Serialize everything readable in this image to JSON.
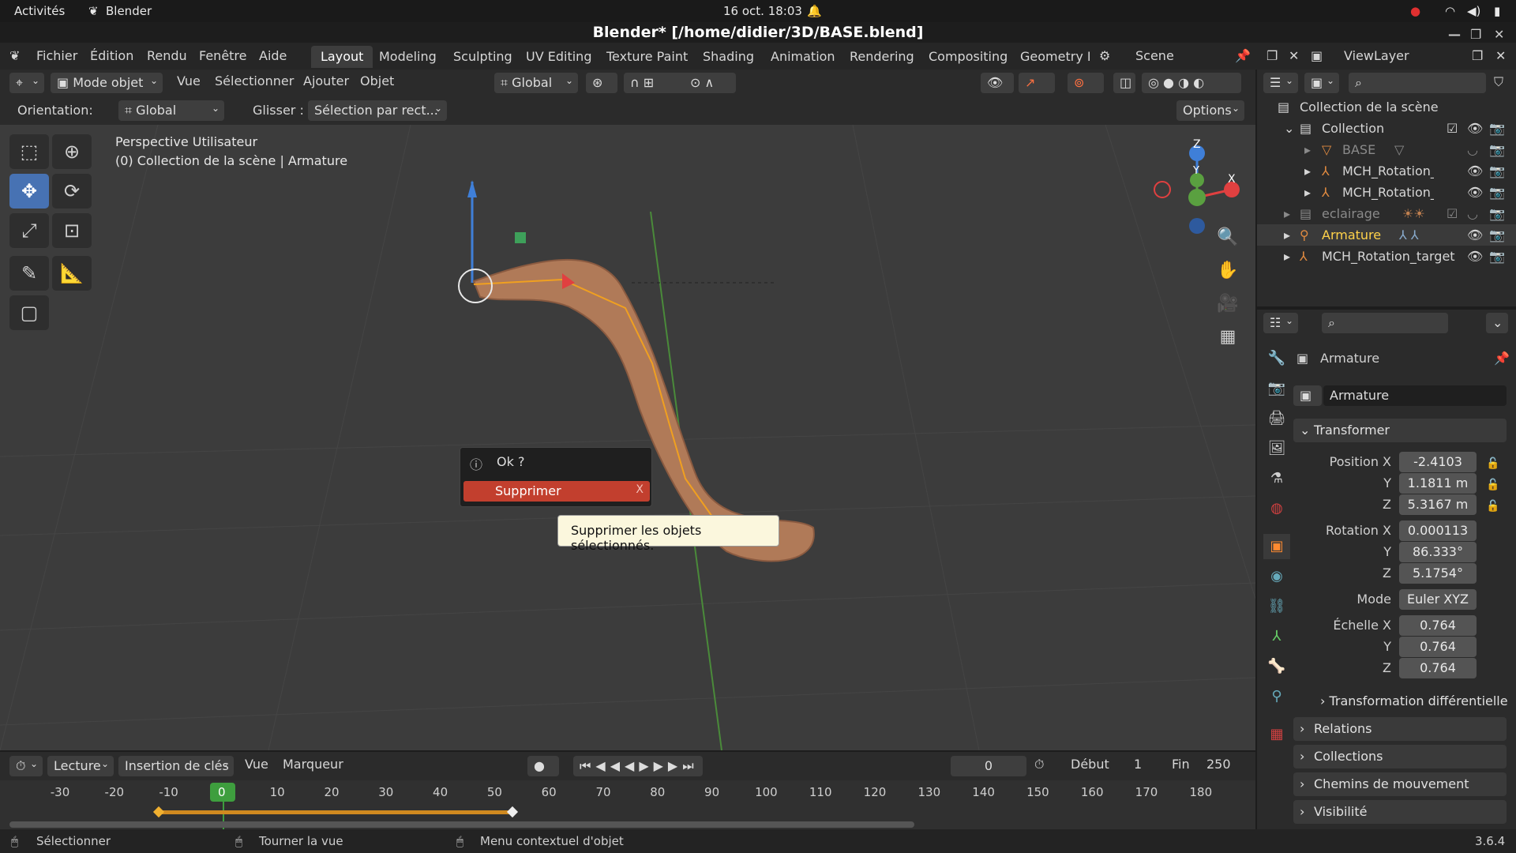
{
  "system": {
    "activities": "Activités",
    "app": "Blender",
    "datetime": "16 oct.  18:03"
  },
  "window": {
    "title": "Blender* [/home/didier/3D/BASE.blend]"
  },
  "menus": [
    "Fichier",
    "Édition",
    "Rendu",
    "Fenêtre",
    "Aide"
  ],
  "workspaces": [
    {
      "label": "Layout",
      "active": true
    },
    {
      "label": "Modeling"
    },
    {
      "label": "Sculpting"
    },
    {
      "label": "UV Editing"
    },
    {
      "label": "Texture Paint"
    },
    {
      "label": "Shading"
    },
    {
      "label": "Animation"
    },
    {
      "label": "Rendering"
    },
    {
      "label": "Compositing"
    },
    {
      "label": "Geometry N"
    }
  ],
  "scene": {
    "name": "Scene",
    "viewlayer": "ViewLayer"
  },
  "header": {
    "mode": "Mode objet",
    "view": "Vue",
    "select": "Sélectionner",
    "add": "Ajouter",
    "object": "Objet",
    "transform_orientation": "Global"
  },
  "toolsettings": {
    "orientation_label": "Orientation:",
    "orientation_value": "Global",
    "drag_label": "Glisser :",
    "drag_value": "Sélection par rect...",
    "options": "Options"
  },
  "viewport": {
    "line1": "Perspective Utilisateur",
    "line2": "(0) Collection de la scène | Armature",
    "axis_x": "X",
    "axis_y": "Y",
    "axis_z": "Z"
  },
  "popup": {
    "title": "Ok ?",
    "action": "Supprimer",
    "shortcut": "X"
  },
  "tooltip": {
    "text": "Supprimer les objets sélectionnés."
  },
  "outliner": {
    "root": "Collection de la scène",
    "rows": [
      {
        "label": "Collection",
        "level": 1
      },
      {
        "label": "BASE",
        "level": 2,
        "dim": true
      },
      {
        "label": "MCH_Rotation_ta",
        "level": 2
      },
      {
        "label": "MCH_Rotation_ta",
        "level": 2
      },
      {
        "label": "eclairage",
        "level": 1,
        "dim": true
      },
      {
        "label": "Armature",
        "level": 1,
        "active": true
      },
      {
        "label": "MCH_Rotation_target",
        "level": 1
      }
    ]
  },
  "properties": {
    "object_name": "Armature",
    "data_name": "Armature",
    "panel_transform": "Transformer",
    "position": {
      "label": "Position X",
      "x": "-2.4103",
      "y": "1.1811 m",
      "z": "5.3167 m"
    },
    "rotation": {
      "label": "Rotation X",
      "x": "0.000113",
      "y": "86.333°",
      "z": "5.1754°"
    },
    "mode": {
      "label": "Mode",
      "value": "Euler XYZ"
    },
    "scale": {
      "label": "Échelle X",
      "x": "0.764",
      "y": "0.764",
      "z": "0.764"
    },
    "axis_y": "Y",
    "axis_z": "Z",
    "delta": "Transformation différentielle",
    "relations": "Relations",
    "collections": "Collections",
    "motion_paths": "Chemins de mouvement",
    "visibility": "Visibilité"
  },
  "timeline": {
    "playback": "Lecture",
    "keying": "Insertion de clés",
    "view": "Vue",
    "marker": "Marqueur",
    "current_frame": "0",
    "start_label": "Début",
    "start": "1",
    "end_label": "Fin",
    "end": "250",
    "ticks": [
      "-30",
      "-20",
      "-10",
      "0",
      "10",
      "20",
      "30",
      "40",
      "50",
      "60",
      "70",
      "80",
      "90",
      "100",
      "110",
      "120",
      "130",
      "140",
      "150",
      "160",
      "170",
      "180"
    ]
  },
  "status": {
    "select": "Sélectionner",
    "rotate": "Tourner la vue",
    "context": "Menu contextuel d'objet",
    "version": "3.6.4"
  }
}
